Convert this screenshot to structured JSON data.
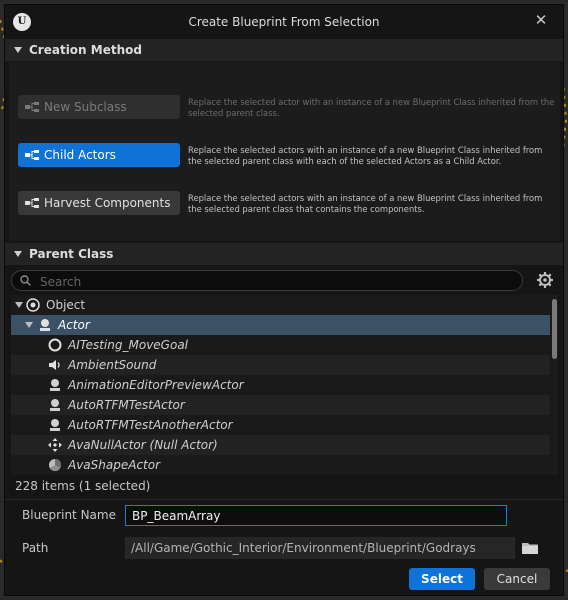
{
  "window": {
    "title": "Create Blueprint From Selection",
    "logo_letter": "U",
    "close_glyph": "✕"
  },
  "creation_method": {
    "header": "Creation Method",
    "options": [
      {
        "label": "New Subclass",
        "state": "disabled",
        "description": "Replace the selected actor with an instance of a new Blueprint Class inherited from the selected parent class."
      },
      {
        "label": "Child Actors",
        "state": "selected",
        "description": "Replace the selected actors with an instance of a new Blueprint Class inherited from the selected parent class with each of the selected Actors as a Child Actor."
      },
      {
        "label": "Harvest Components",
        "state": "normal",
        "description": "Replace the selected actors with an instance of a new Blueprint Class inherited from the selected parent class that contains the components."
      }
    ]
  },
  "parent_class": {
    "header": "Parent Class",
    "search_placeholder": "Search",
    "items": [
      {
        "label": "Object",
        "icon": "object-icon"
      },
      {
        "label": "Actor",
        "icon": "actor-icon",
        "selected": true
      },
      {
        "label": "AITesting_MoveGoal",
        "icon": "ring-icon"
      },
      {
        "label": "AmbientSound",
        "icon": "speaker-icon"
      },
      {
        "label": "AnimationEditorPreviewActor",
        "icon": "actor-icon"
      },
      {
        "label": "AutoRTFMTestActor",
        "icon": "actor-icon"
      },
      {
        "label": "AutoRTFMTestAnotherActor",
        "icon": "actor-icon"
      },
      {
        "label": "AvaNullActor (Null Actor)",
        "icon": "move-icon"
      },
      {
        "label": "AvaShapeActor",
        "icon": "shape-icon"
      }
    ],
    "status": "228 items (1 selected)"
  },
  "form": {
    "name_label": "Blueprint Name",
    "name_value": "BP_BeamArray",
    "path_label": "Path",
    "path_value": "/All/Game/Gothic_Interior/Environment/Blueprint/Godrays"
  },
  "buttons": {
    "select": "Select",
    "cancel": "Cancel"
  },
  "colors": {
    "accent": "#0e72d6",
    "selection_row": "#3b5266",
    "background": "#151515"
  }
}
